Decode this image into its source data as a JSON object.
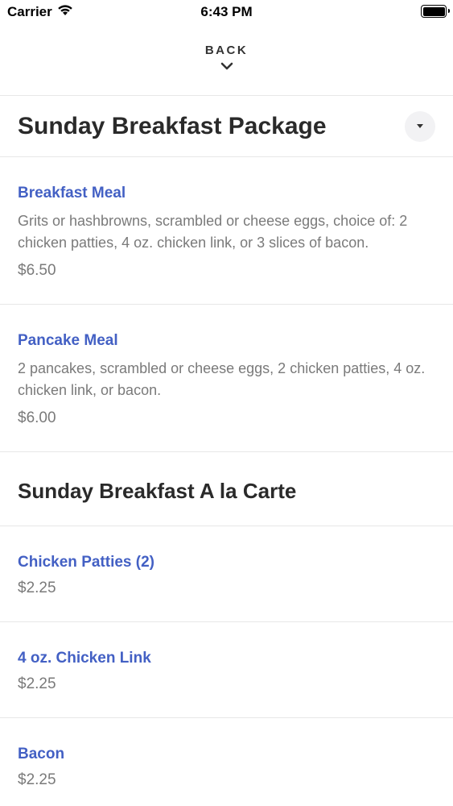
{
  "status_bar": {
    "carrier": "Carrier",
    "time": "6:43 PM"
  },
  "nav": {
    "back_label": "BACK"
  },
  "package_section": {
    "title": "Sunday Breakfast Package",
    "items": [
      {
        "name": "Breakfast Meal",
        "description": "Grits or hashbrowns, scrambled or cheese eggs, choice of: 2 chicken patties, 4 oz. chicken link, or 3 slices of bacon.",
        "price": "$6.50"
      },
      {
        "name": "Pancake Meal",
        "description": "2 pancakes, scrambled or cheese eggs, 2 chicken patties, 4 oz. chicken link, or bacon.",
        "price": "$6.00"
      }
    ]
  },
  "a_la_carte_section": {
    "title": "Sunday Breakfast A la Carte",
    "items": [
      {
        "name": "Chicken Patties (2)",
        "price": "$2.25"
      },
      {
        "name": "4 oz. Chicken Link",
        "price": "$2.25"
      },
      {
        "name": "Bacon",
        "price": "$2.25"
      }
    ]
  },
  "colors": {
    "link_blue": "#4360c4",
    "text_gray": "#7a7a7a",
    "divider": "#e7e7e7"
  }
}
